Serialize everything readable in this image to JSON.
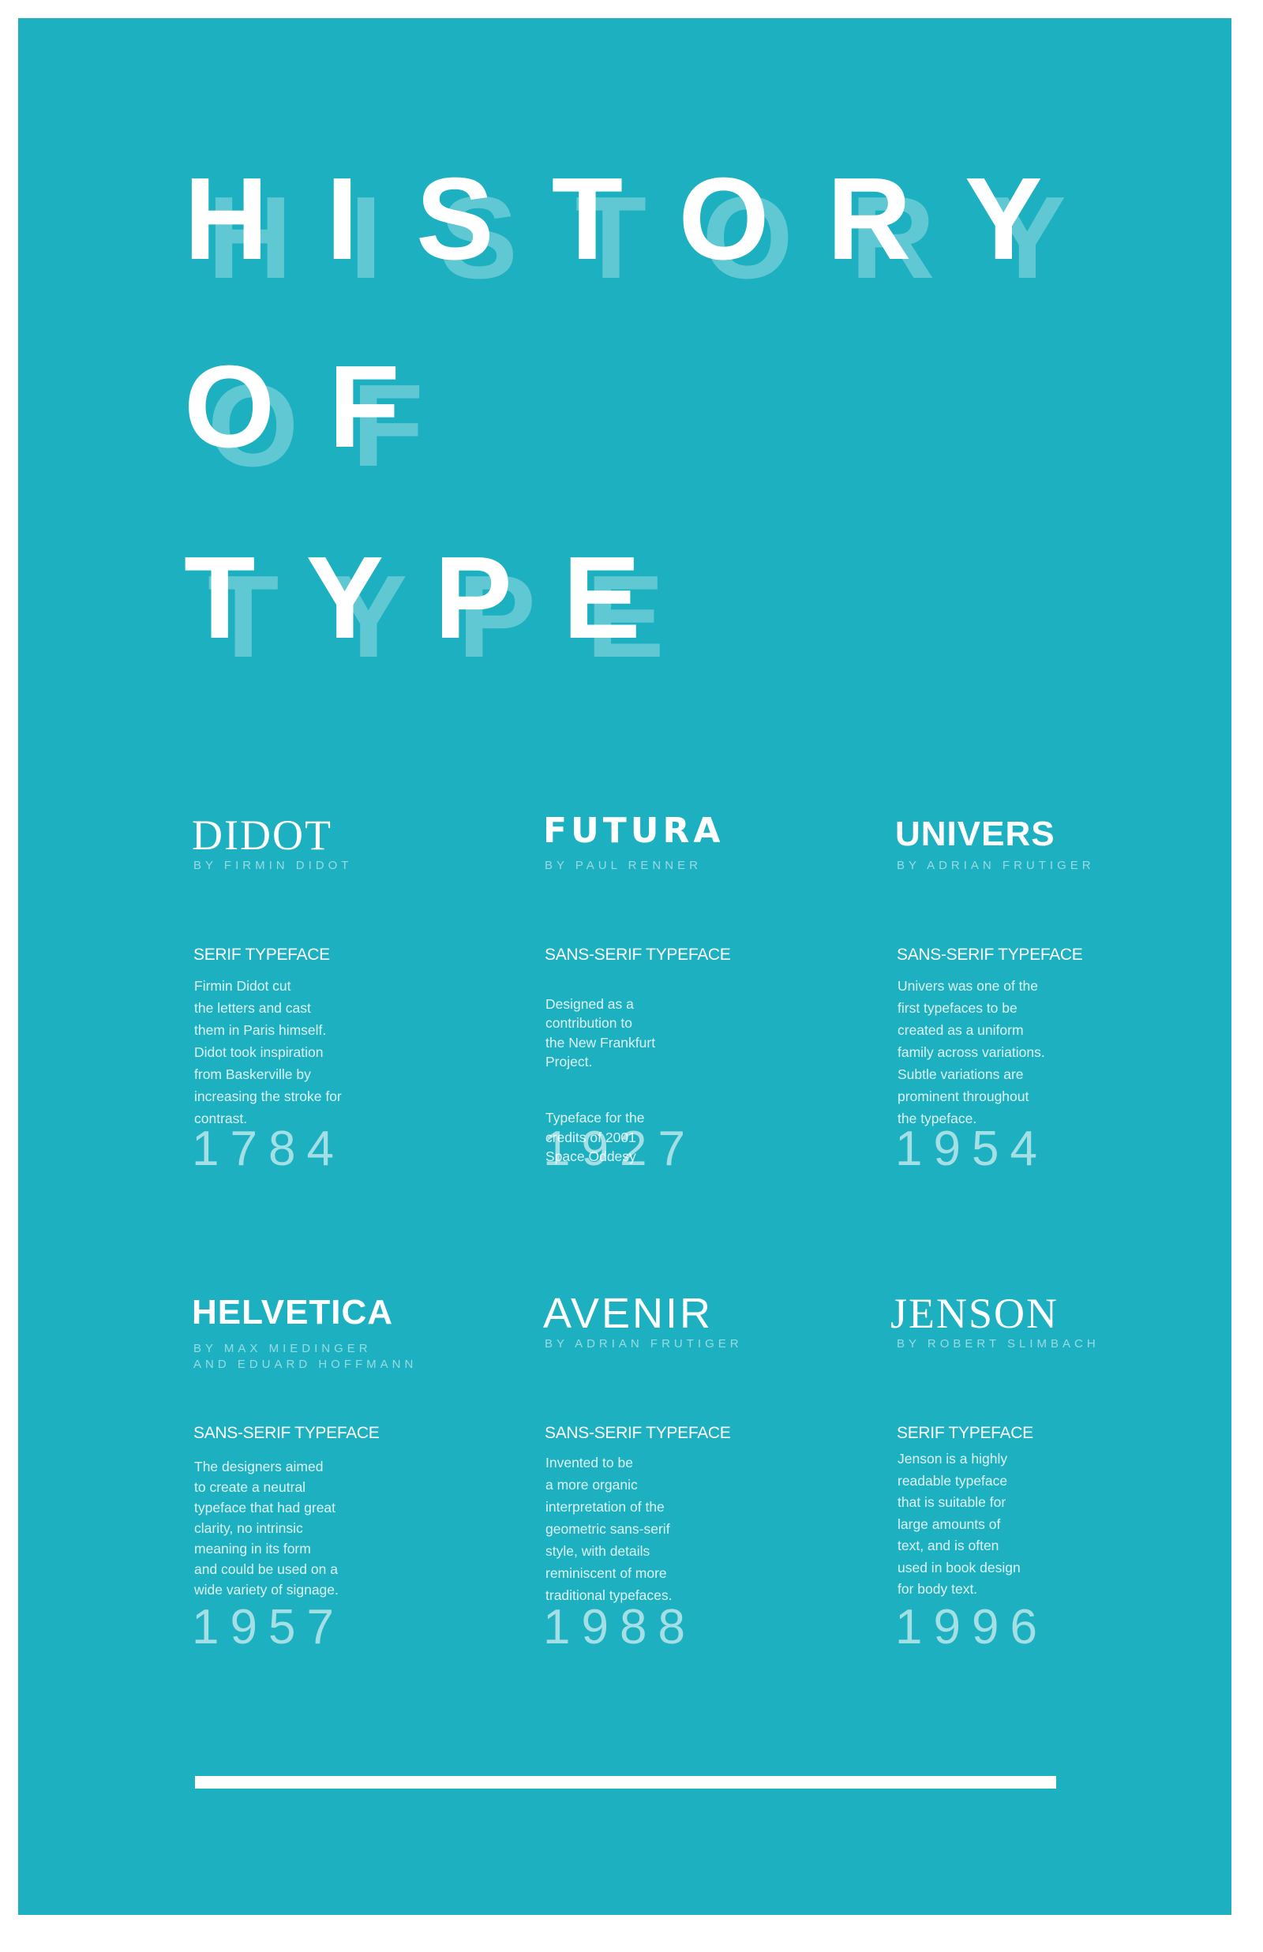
{
  "poster": {
    "background": "#1cb0c0",
    "accent": "#ffffff",
    "title": {
      "line1": "HISTORY",
      "line2": "OF",
      "line3": "TYPE"
    }
  },
  "typefaces": [
    {
      "name": "DIDOT",
      "designer": "BY FIRMIN DIDOT",
      "category": "SERIF TYPEFACE",
      "description": "Firmin Didot cut\nthe letters and cast\nthem in Paris himself.\nDidot took inspiration\nfrom Baskerville by\nincreasing the stroke for\ncontrast.",
      "year": "1784"
    },
    {
      "name": "FUTURA",
      "designer": "BY PAUL RENNER",
      "category": "SANS-SERIF TYPEFACE",
      "description": "Designed as a\ncontribution to\nthe New Frankfurt\nProject.",
      "description_2": "Typeface for the\ncredits of 2001\nSpace Oddesy",
      "year": "1927"
    },
    {
      "name": "UNIVERS",
      "designer": "BY ADRIAN FRUTIGER",
      "category": "SANS-SERIF TYPEFACE",
      "description": "Univers was one of the\nfirst typefaces to be\ncreated as a uniform\nfamily across variations.\nSubtle variations are\nprominent throughout\nthe typeface.",
      "year": "1954"
    },
    {
      "name": "HELVETICA",
      "designer": "BY MAX MIEDINGER\nAND EDUARD HOFFMANN",
      "category": "SANS-SERIF TYPEFACE",
      "description": "The designers aimed\nto create a neutral\ntypeface that had great\nclarity, no intrinsic\nmeaning in its form\nand could be used on a\nwide variety of signage.",
      "year": "1957"
    },
    {
      "name": "AVENIR",
      "designer": "BY ADRIAN FRUTIGER",
      "category": "SANS-SERIF TYPEFACE",
      "description": "Invented to be\na more organic\ninterpretation of the\ngeometric sans-serif\nstyle, with details\nreminiscent of more\ntraditional typefaces.",
      "year": "1988"
    },
    {
      "name": "JENSON",
      "designer": "BY ROBERT SLIMBACH",
      "category": "SERIF TYPEFACE",
      "description": "Jenson is a highly\nreadable typeface\nthat is suitable for\nlarge amounts of\ntext, and is often\nused in book design\nfor body text.",
      "year": "1996"
    }
  ]
}
